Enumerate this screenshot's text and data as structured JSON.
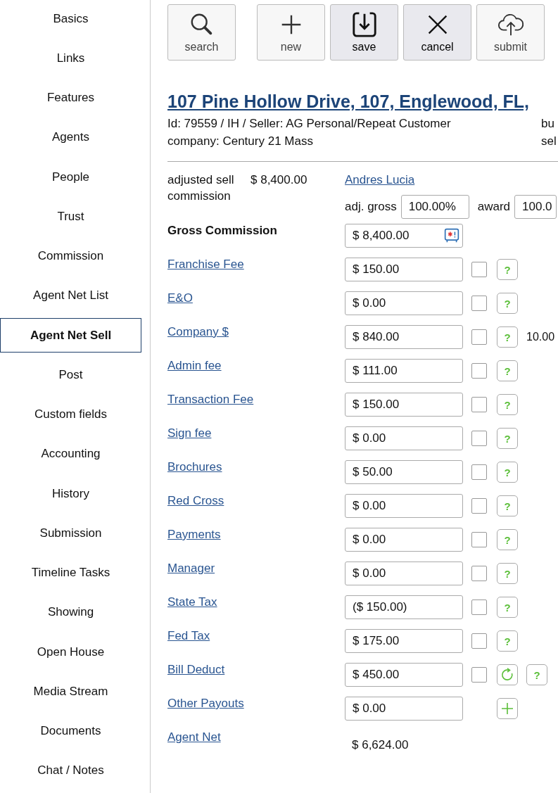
{
  "sidebar": {
    "items": [
      {
        "label": "Basics",
        "selected": false
      },
      {
        "label": "Links",
        "selected": false
      },
      {
        "label": "Features",
        "selected": false
      },
      {
        "label": "Agents",
        "selected": false
      },
      {
        "label": "People",
        "selected": false
      },
      {
        "label": "Trust",
        "selected": false
      },
      {
        "label": "Commission",
        "selected": false
      },
      {
        "label": "Agent Net List",
        "selected": false
      },
      {
        "label": "Agent Net Sell",
        "selected": true
      },
      {
        "label": "Post",
        "selected": false
      },
      {
        "label": "Custom fields",
        "selected": false
      },
      {
        "label": "Accounting",
        "selected": false
      },
      {
        "label": "History",
        "selected": false
      },
      {
        "label": "Submission",
        "selected": false
      },
      {
        "label": "Timeline Tasks",
        "selected": false
      },
      {
        "label": "Showing",
        "selected": false
      },
      {
        "label": "Open House",
        "selected": false
      },
      {
        "label": "Media Stream",
        "selected": false
      },
      {
        "label": "Documents",
        "selected": false
      },
      {
        "label": "Chat / Notes",
        "selected": false
      }
    ]
  },
  "toolbar": [
    {
      "kind": "search",
      "label": "search",
      "pressed": false
    },
    {
      "kind": "new",
      "label": "new",
      "pressed": false
    },
    {
      "kind": "save",
      "label": "save",
      "pressed": true
    },
    {
      "kind": "cancel",
      "label": "cancel",
      "pressed": true
    },
    {
      "kind": "submit",
      "label": "submit",
      "pressed": false
    }
  ],
  "header": {
    "title": "107 Pine Hollow Drive, 107, Englewood, FL,",
    "info_lines": [
      "Id: 79559 / IH / Seller: AG Personal/Repeat Customer",
      "company: Century 21 Mass"
    ],
    "side_lines": [
      "bu",
      "sel"
    ]
  },
  "summary": {
    "label": "adjusted sell commission",
    "amount": "$ 8,400.00",
    "agent": "Andres Lucia",
    "adj_gross_label": "adj. gross",
    "adj_gross": "100.00%",
    "award_label": "award",
    "award": "100.0"
  },
  "gross": {
    "label": "Gross Commission",
    "value": "$ 8,400.00"
  },
  "rows": [
    {
      "kind": "fee",
      "label": "Franchise Fee",
      "value": "$ 150.00",
      "checked": false,
      "help": "?"
    },
    {
      "kind": "fee",
      "label": "E&O",
      "value": "$ 0.00",
      "checked": false,
      "help": "?"
    },
    {
      "kind": "fee",
      "label": "Company $",
      "value": "$ 840.00",
      "checked": false,
      "help": "?",
      "note": "10.00"
    },
    {
      "kind": "fee",
      "label": "Admin fee",
      "value": "$ 111.00",
      "checked": false,
      "help": "?"
    },
    {
      "kind": "fee",
      "label": "Transaction Fee",
      "value": "$ 150.00",
      "checked": false,
      "help": "?"
    },
    {
      "kind": "fee",
      "label": "Sign fee",
      "value": "$ 0.00",
      "checked": false,
      "help": "?"
    },
    {
      "kind": "fee",
      "label": "Brochures",
      "value": "$ 50.00",
      "checked": false,
      "help": "?"
    },
    {
      "kind": "fee",
      "label": "Red Cross",
      "value": "$ 0.00",
      "checked": false,
      "help": "?"
    },
    {
      "kind": "fee",
      "label": "Payments",
      "value": "$ 0.00",
      "checked": false,
      "help": "?"
    },
    {
      "kind": "fee",
      "label": "Manager",
      "value": "$ 0.00",
      "checked": false,
      "help": "?"
    },
    {
      "kind": "fee",
      "label": "State Tax",
      "value": "($ 150.00)",
      "checked": false,
      "help": "?"
    },
    {
      "kind": "fee",
      "label": "Fed Tax",
      "value": "$ 175.00",
      "checked": false,
      "help": "?"
    },
    {
      "kind": "refresh",
      "label": "Bill Deduct",
      "value": "$ 450.00",
      "checked": false,
      "help": "?"
    },
    {
      "kind": "add",
      "label": "Other Payouts",
      "value": "$ 0.00"
    },
    {
      "kind": "total",
      "label": "Agent Net",
      "value": "$ 6,624.00"
    }
  ]
}
